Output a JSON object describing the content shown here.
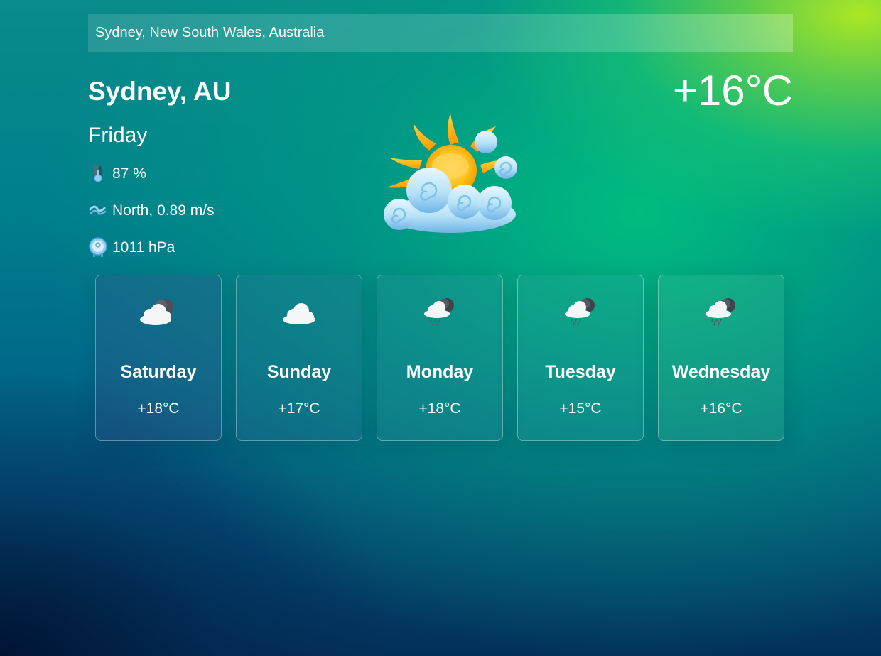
{
  "search": {
    "value": "Sydney, New South Wales, Australia",
    "placeholder": ""
  },
  "current": {
    "city": "Sydney, AU",
    "temperature": "+16°C",
    "day": "Friday",
    "humidity": "87 %",
    "wind": "North, 0.89 m/s",
    "pressure": "1011 hPa",
    "condition_icon": "sun-behind-clouds-icon"
  },
  "forecast": [
    {
      "day": "Saturday",
      "temp": "+18°C",
      "icon": "cloudy-night-icon"
    },
    {
      "day": "Sunday",
      "temp": "+17°C",
      "icon": "cloud-icon"
    },
    {
      "day": "Monday",
      "temp": "+18°C",
      "icon": "rain-night-icon"
    },
    {
      "day": "Tuesday",
      "temp": "+15°C",
      "icon": "rain-night-icon"
    },
    {
      "day": "Wednesday",
      "temp": "+16°C",
      "icon": "rain-night-icon"
    }
  ],
  "colors": {
    "text": "#ffffff",
    "bg_top_right": "#a8e614",
    "bg_mid": "#00c07a",
    "bg_bottom": "#03305a"
  }
}
